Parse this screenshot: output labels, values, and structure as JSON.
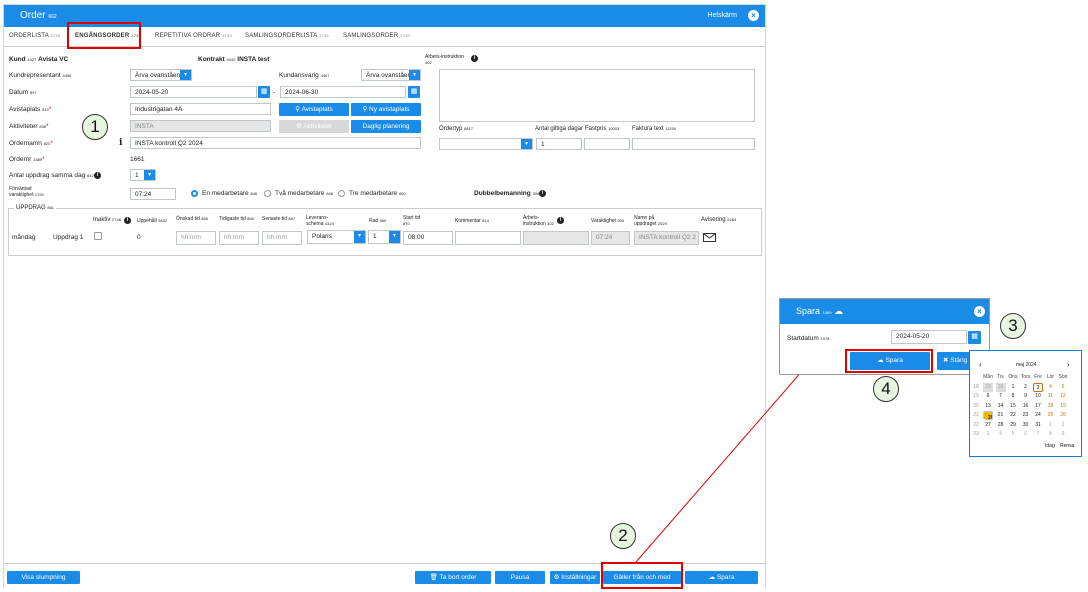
{
  "window": {
    "title": "Order",
    "title_code": "662",
    "fullscreen": "Helskärm"
  },
  "tabs": [
    {
      "label": "ORDERLISTA",
      "code": "2735"
    },
    {
      "label": "ENGÅNGSORDER",
      "code": "2738"
    },
    {
      "label": "REPETITIVA ORDRAR",
      "code": "2733"
    },
    {
      "label": "SAMLINGSORDERLISTA",
      "code": "2746"
    },
    {
      "label": "SAMLINGSORDER",
      "code": "2749"
    }
  ],
  "form": {
    "kund_label": "Kund",
    "kund_code": "4427",
    "kund_value": "Avista VC",
    "kontrakt_label": "Kontrakt",
    "kontrakt_code": "4442",
    "kontrakt_value": "INSTA test",
    "kundrep_label": "Kundrepresentant",
    "kundrep_code": "4456",
    "kundrep_value": "Ärva ovanstående",
    "kundansvarig_label": "Kundansvarig",
    "kundansvarig_code": "4467",
    "kundansvarig_value": "Ärva ovanstående",
    "datum_label": "Datum",
    "datum_code": "857",
    "datum_from": "2024-05-20",
    "datum_sep": "-",
    "datum_to": "2024-06-30",
    "avistaplats_label": "Avistaplats",
    "avistaplats_code": "810",
    "avistaplats_value": "Industrigatan 4A",
    "btn_avistaplats": "Avistaplats",
    "btn_ny_avistaplats": "Ny avistaplats",
    "aktiviteter_label": "Aktiviteter",
    "aktiviteter_code": "836",
    "aktiviteter_value": "INSTA",
    "btn_aktiviteter": "Aktiviteter",
    "btn_daglig": "Daglig planering",
    "ordernamn_label": "Ordernamn",
    "ordernamn_code": "820",
    "ordernamn_value": "INSTA kontroll Q2 2024",
    "ordernr_label": "Ordernr",
    "ordernr_code": "1589",
    "ordernr_value": "1661",
    "antal_label": "Antal uppdrag samma dag",
    "antal_code": "842",
    "antal_value": "1",
    "forvantad_label": "Förväntad varaktighet",
    "forvantad_code": "1726",
    "forvantad_value": "07:24",
    "radio1": "En medarbetare",
    "radio1_code": "846",
    "radio2": "Två medarbetare",
    "radio2_code": "848",
    "radio3": "Tre medarbetare",
    "radio3_code": "850",
    "dubbel_label": "Dubbelbemanning",
    "dubbel_code": "3069",
    "arbets_label": "Arbets-instruktion",
    "arbets_code": "402",
    "ordertyp_label": "Ordertyp",
    "ordertyp_code": "8817",
    "antal_giltiga_label": "Antal giltiga dagar",
    "antal_giltiga_value": "1",
    "fastpris_label": "Fastpris",
    "fastpris_code": "10003",
    "faktura_label": "Faktura text",
    "faktura_code": "11159"
  },
  "uppdrag": {
    "legend": "UPPDRAG",
    "legend_code": "861",
    "headers": {
      "inaktiv": "Inaktiv",
      "inaktiv_code": "2746",
      "uppehall": "Uppehåll",
      "uppehall_code": "3832",
      "onskad": "Önskad tid",
      "onskad_code": "865",
      "tidigaste": "Tidigaste tid",
      "tidigaste_code": "866",
      "senaste": "Senaste tid",
      "senaste_code": "867",
      "leverans": "Leverans-schema",
      "leverans_code": "4324",
      "rad": "Rad",
      "rad_code": "960",
      "start": "Start tid",
      "start_code": "870",
      "kommentar": "Kommentar",
      "kommentar_code": "814",
      "arbets": "Arbets-instruktion",
      "arbets_code": "402",
      "varaktighet": "Varaktighet",
      "varaktighet_code": "995",
      "namn": "Namn på uppdraget",
      "namn_code": "2529",
      "avisering": "Avisering",
      "avisering_code": "2264"
    },
    "row": {
      "day": "måndag",
      "name": "Uppdrag 1",
      "uppehall": "0",
      "onskad_ph": "hh:mm",
      "tidigaste_ph": "hh:mm",
      "senaste_ph": "hh:mm",
      "leverans": "Polaris",
      "rad": "1",
      "start": "08:00",
      "varaktighet": "07:24",
      "namn": "INSTA kontroll Q2 2"
    }
  },
  "bottom": {
    "visa": "Visa slumpning",
    "tabort": "Ta bort order",
    "pausa": "Pausa",
    "installningar": "Inställningar",
    "galler": "Gäller från och med",
    "spara": "Spara"
  },
  "popup": {
    "title": "Spara",
    "title_code": "1069",
    "startdatum_label": "Startdatum",
    "startdatum_code": "1078",
    "startdatum_value": "2024-05-20",
    "btn_spara": "Spara",
    "btn_stang": "Stäng"
  },
  "calendar": {
    "month": "maj 2024",
    "weekdays": [
      "Mån",
      "Tis",
      "Ons",
      "Tors",
      "Fre",
      "Lör",
      "Sön"
    ],
    "weeks": [
      "18",
      "19",
      "20",
      "21",
      "22",
      "23"
    ],
    "days": [
      [
        "29",
        "30",
        "1",
        "2",
        "3",
        "4",
        "5"
      ],
      [
        "6",
        "7",
        "8",
        "9",
        "10",
        "11",
        "12"
      ],
      [
        "13",
        "14",
        "15",
        "16",
        "17",
        "18",
        "19"
      ],
      [
        "20",
        "21",
        "22",
        "23",
        "24",
        "25",
        "26"
      ],
      [
        "27",
        "28",
        "29",
        "30",
        "31",
        "1",
        "2"
      ],
      [
        "3",
        "4",
        "5",
        "6",
        "7",
        "8",
        "9"
      ]
    ],
    "idag": "Idag",
    "rensa": "Rensa"
  },
  "callouts": [
    "1",
    "2",
    "3",
    "4"
  ],
  "colors": {
    "accent": "#1a8be6",
    "highlight": "#e00000",
    "callout_bg": "#e8f5e0",
    "selected_day": "#f5b800"
  }
}
